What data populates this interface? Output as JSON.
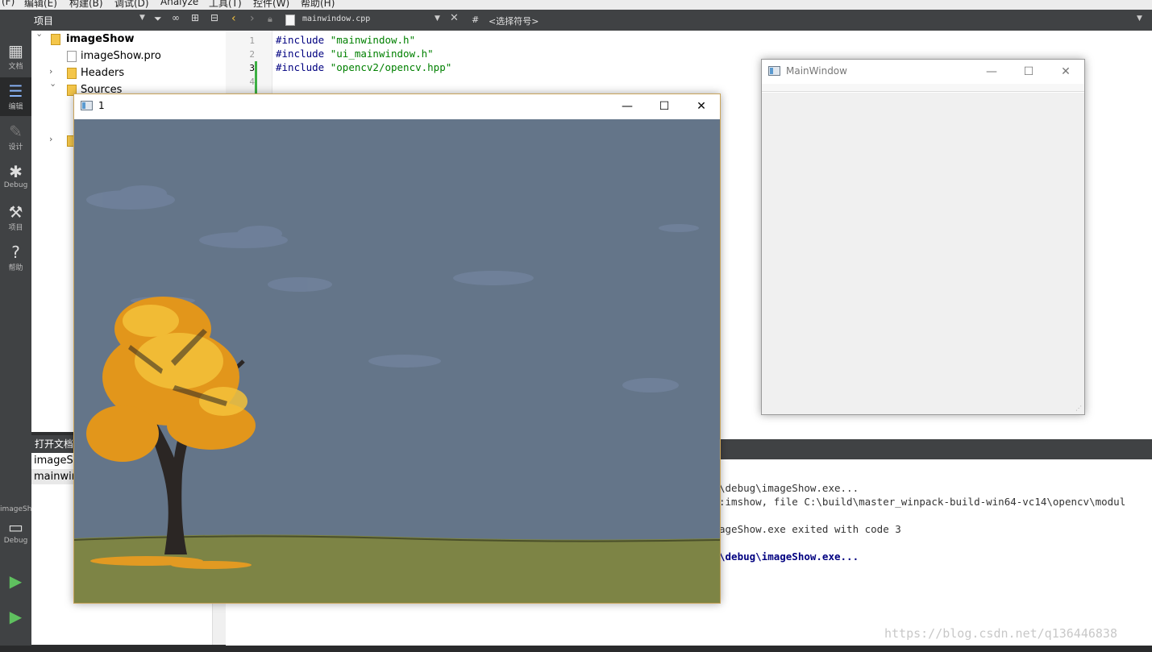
{
  "menubar": {
    "items": [
      "(F)",
      "编辑(E)",
      "构建(B)",
      "调试(D)",
      "Analyze",
      "工具(T)",
      "控件(W)",
      "帮助(H)"
    ]
  },
  "modebar": {
    "items": [
      {
        "label": "文档",
        "icon": "grid-icon"
      },
      {
        "label": "编辑",
        "icon": "edit-icon"
      },
      {
        "label": "设计",
        "icon": "pencil-icon"
      },
      {
        "label": "Debug",
        "icon": "bug-icon"
      },
      {
        "label": "项目",
        "icon": "wrench-icon"
      },
      {
        "label": "帮助",
        "icon": "help-icon"
      }
    ],
    "kit_name": "imageShow",
    "kit_mode": "Debug"
  },
  "project_panel": {
    "title": "项目",
    "tree": [
      {
        "label": "imageShow",
        "bold": true
      },
      {
        "label": "imageShow.pro"
      },
      {
        "label": "Headers"
      },
      {
        "label": "Sources"
      }
    ]
  },
  "editor_toolbar": {
    "file_name": "mainwindow.cpp",
    "hash": "#",
    "symbol_placeholder": "<选择符号>"
  },
  "editor": {
    "line_numbers": [
      "1",
      "2",
      "3",
      "4"
    ],
    "lines": [
      {
        "kw": "#include",
        "str": "\"mainwindow.h\""
      },
      {
        "kw": "#include",
        "str": "\"ui_mainwindow.h\""
      },
      {
        "kw": "#include",
        "str": "\"opencv2/opencv.hpp\""
      }
    ]
  },
  "open_documents": {
    "title": "打开文档",
    "items": [
      "imageSh",
      "mainwin"
    ]
  },
  "output": {
    "lines": [
      "\\debug\\imageShow.exe...",
      ":imshow, file C:\\build\\master_winpack-build-win64-vc14\\opencv\\modul",
      "",
      "ageShow.exe exited with code 3",
      "",
      "\\debug\\imageShow.exe..."
    ]
  },
  "image_window": {
    "title": "1",
    "minimize": "—",
    "maximize": "☐",
    "close": "✕"
  },
  "main_window": {
    "title": "MainWindow",
    "minimize": "—",
    "maximize": "☐",
    "close": "✕"
  },
  "watermark": "https://blog.csdn.net/q136446838",
  "colors": {
    "sky": "#647589",
    "grass": "#7d8445",
    "accent_border": "#c9a45a"
  }
}
